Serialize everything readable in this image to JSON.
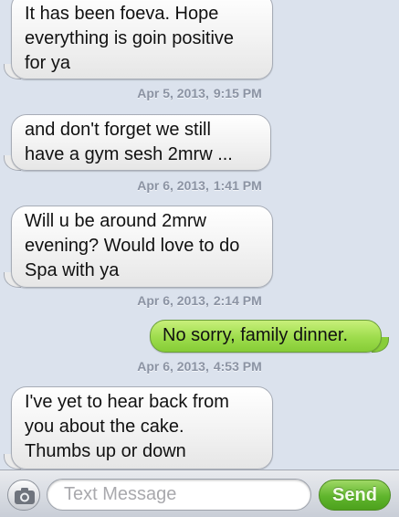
{
  "messages": [
    {
      "direction": "incoming",
      "lines": [
        "It has been foeva. Hope",
        "everything is goin positive",
        "for ya"
      ]
    },
    {
      "direction": "incoming",
      "lines": [
        "and don't forget we still",
        "have a gym sesh 2mrw ..."
      ]
    },
    {
      "direction": "incoming",
      "lines": [
        "Will u be around 2mrw",
        "evening? Would love to do",
        "Spa with ya"
      ]
    },
    {
      "direction": "outgoing",
      "lines": [
        "No sorry, family dinner."
      ]
    },
    {
      "direction": "incoming",
      "lines": [
        "I've yet to hear back from",
        "you about the cake.",
        "Thumbs up or down"
      ]
    }
  ],
  "timestamps": [
    {
      "date": "Apr 5, 2013,",
      "time": "9:15 PM"
    },
    {
      "date": "Apr 6, 2013,",
      "time": "1:41 PM"
    },
    {
      "date": "Apr 6, 2013,",
      "time": "2:14 PM"
    },
    {
      "date": "Apr 6, 2013,",
      "time": "4:53 PM"
    }
  ],
  "input_bar": {
    "camera_icon": "camera-icon",
    "placeholder": "Text Message",
    "value": "",
    "send_label": "Send"
  },
  "colors": {
    "background": "#dbe2ed",
    "incoming_bubble": "#f2f2f2",
    "outgoing_bubble": "#9ddc4c",
    "send_button": "#5fb52c",
    "timestamp": "#8b93a3"
  }
}
